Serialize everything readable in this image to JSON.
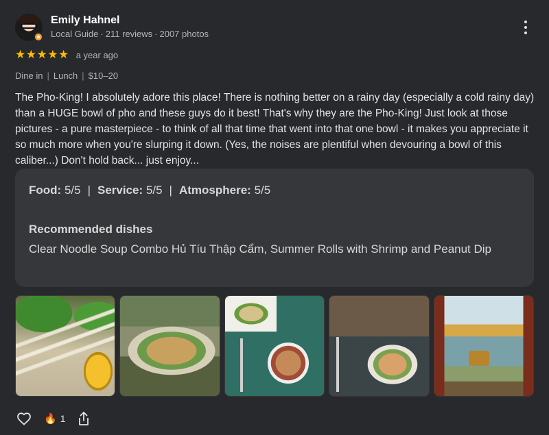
{
  "reviewer": {
    "name": "Emily Hahnel",
    "badge": "Local Guide",
    "reviews": "211 reviews",
    "photos": "2007 photos",
    "separator": "·"
  },
  "rating": {
    "stars": "★★★★★",
    "stars_value": 5,
    "time": "a year ago"
  },
  "tags": {
    "service": "Dine in",
    "meal": "Lunch",
    "price": "$10–20",
    "separator": "|"
  },
  "review_text": "The Pho-King! I absolutely adore this place! There is nothing better on a rainy day (especially a cold rainy day) than a HUGE bowl of pho and these guys do it best! That's why they are the Pho-King! Just look at those pictures - a pure masterpiece - to think of all that time that went into that one bowl - it makes you appreciate it so much more when you're slurping it down. (Yes, the noises are plentiful when devouring a bowl of this caliber...) Don't hold back... just enjoy...",
  "sub_ratings": {
    "food_label": "Food:",
    "food_value": "5/5",
    "service_label": "Service:",
    "service_value": "5/5",
    "atmosphere_label": "Atmosphere:",
    "atmosphere_value": "5/5",
    "pipe": "|"
  },
  "recommended": {
    "title": "Recommended dishes",
    "dishes": "Clear Noodle Soup Combo Hủ Tíu Thập Cẩm, Summer Rolls with Shrimp and Peanut Dip"
  },
  "photos": [
    {
      "subject": "pho-garnish-photo"
    },
    {
      "subject": "pho-bowl-photo"
    },
    {
      "subject": "pho-table-photo"
    },
    {
      "subject": "pho-bowl-closeup-photo"
    },
    {
      "subject": "wall-mural-photo"
    }
  ],
  "footer": {
    "like_icon": "heart-outline-icon",
    "reaction_icon": "🔥",
    "reaction_count": "1",
    "share_icon": "share-icon"
  },
  "colors": {
    "background": "#28292c",
    "card": "#36373a",
    "star": "#fbbc04",
    "secondary_text": "#b5b5b5"
  }
}
